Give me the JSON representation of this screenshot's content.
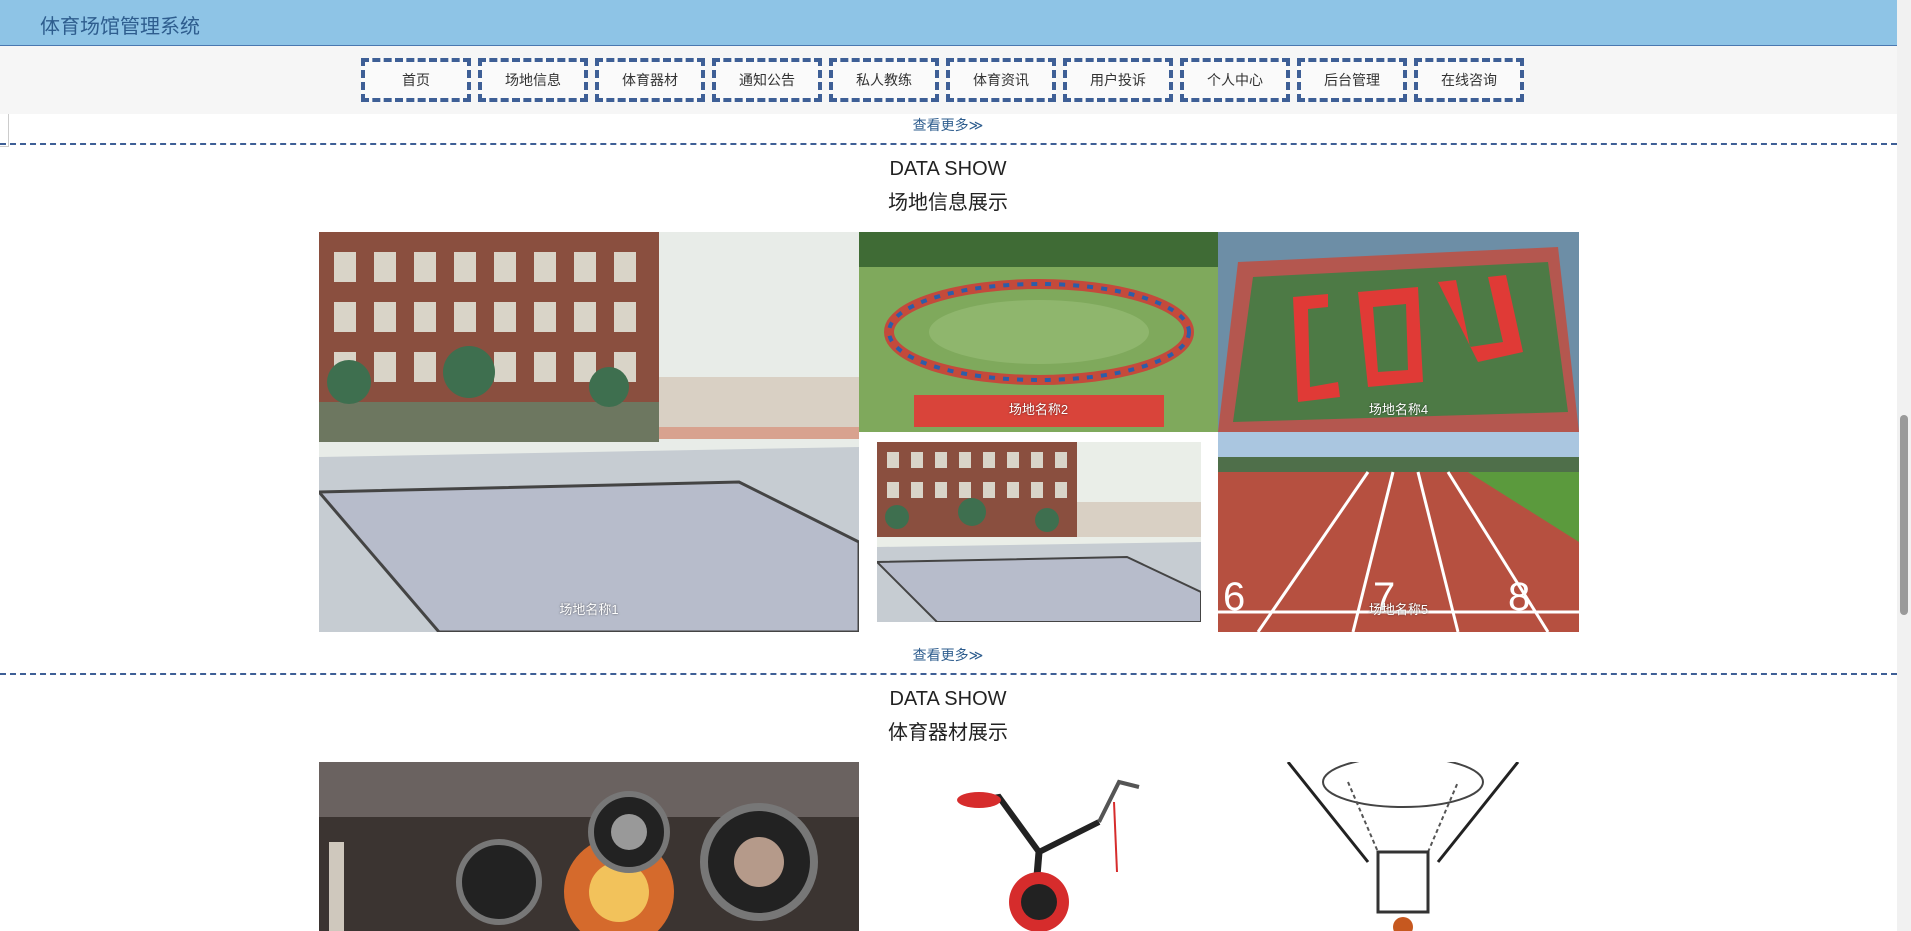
{
  "app": {
    "title": "体育场馆管理系统"
  },
  "nav": [
    {
      "label": "首页"
    },
    {
      "label": "场地信息"
    },
    {
      "label": "体育器材"
    },
    {
      "label": "通知公告"
    },
    {
      "label": "私人教练"
    },
    {
      "label": "体育资讯"
    },
    {
      "label": "用户投诉"
    },
    {
      "label": "个人中心"
    },
    {
      "label": "后台管理"
    },
    {
      "label": "在线咨询"
    }
  ],
  "more_label": "查看更多≫",
  "venues": {
    "heading_en": "DATA SHOW",
    "heading_cn": "场地信息展示",
    "items": [
      {
        "name": "场地名称1"
      },
      {
        "name": "场地名称2"
      },
      {
        "name": "场地名称4"
      },
      {
        "name": ""
      },
      {
        "name": "场地名称5"
      }
    ]
  },
  "equipment": {
    "heading_en": "DATA SHOW",
    "heading_cn": "体育器材展示"
  },
  "colors": {
    "header_bg": "#8ec4e6",
    "accent": "#3e5f96",
    "title_text": "#2e5d8e"
  }
}
